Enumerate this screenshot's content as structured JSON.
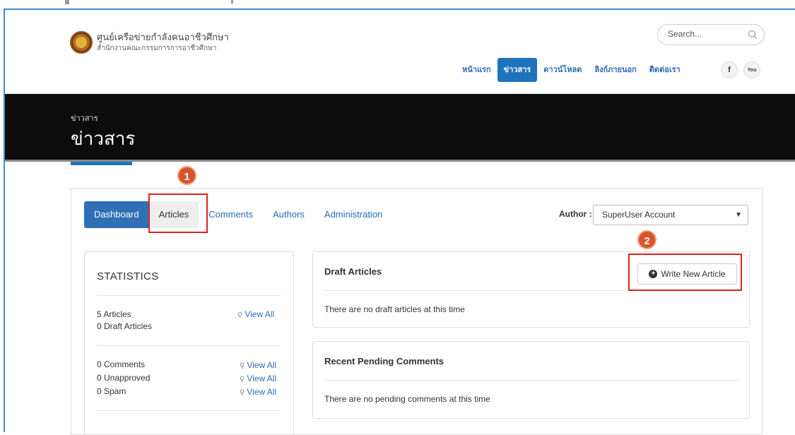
{
  "header": {
    "org_title": "ศูนย์เครือข่ายกำลังคนอาชีวศึกษา",
    "org_subtitle": "สำนักงานคณะกรรมการการอาชีวศึกษา",
    "search_placeholder": "Search...",
    "nav": [
      {
        "label": "หน้าแรก",
        "active": false
      },
      {
        "label": "ข่าวสาร",
        "active": true
      },
      {
        "label": "ดาวน์โหลด",
        "active": false
      },
      {
        "label": "ลิงก์ภายนอก",
        "active": false
      },
      {
        "label": "ติดต่อเรา",
        "active": false
      }
    ],
    "social": [
      {
        "label": "f",
        "icon": "facebook-icon"
      },
      {
        "label": "You",
        "icon": "youtube-icon"
      }
    ]
  },
  "banner": {
    "breadcrumb": "ข่าวสาร",
    "title": "ข่าวสาร"
  },
  "blog": {
    "tabs": [
      {
        "label": "Dashboard",
        "style": "primary"
      },
      {
        "label": "Articles",
        "style": "gray"
      },
      {
        "label": "Comments",
        "style": "link"
      },
      {
        "label": "Authors",
        "style": "link"
      },
      {
        "label": "Administration",
        "style": "link"
      }
    ],
    "author_label": "Author :",
    "author_selected": "SuperUser Account",
    "stats": {
      "title": "STATISTICS",
      "articles": "5 Articles",
      "draft_articles": "0 Draft Articles",
      "comments": "0 Comments",
      "unapproved": "0 Unapproved",
      "spam": "0 Spam",
      "view_all": "View All"
    },
    "draft_card": {
      "title": "Draft Articles",
      "button": "Write New Article",
      "message": "There are no draft articles at this time"
    },
    "pending_card": {
      "title": "Recent Pending Comments",
      "message": "There are no pending comments at this time"
    }
  },
  "annotations": {
    "marker_1": "1",
    "marker_2": "2",
    "color": "#d9532b",
    "box_color": "#e02020"
  },
  "colors": {
    "accent": "#1e73be",
    "banner_bg": "#0c0c0c"
  }
}
